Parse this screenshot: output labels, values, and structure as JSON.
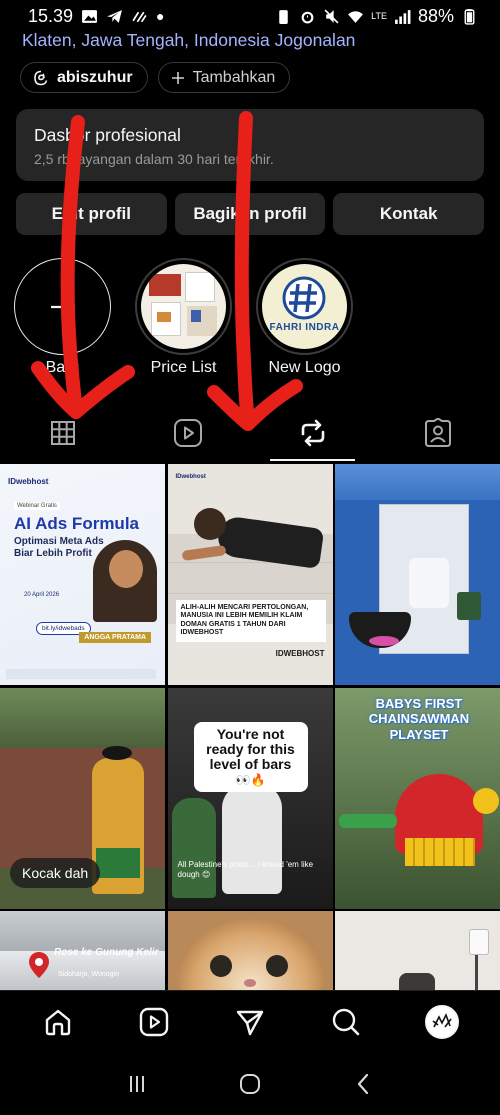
{
  "status_bar": {
    "time": "15.39",
    "battery_percent": "88%",
    "lte_label": "LTE",
    "volte_label": "Vo) LTE"
  },
  "profile": {
    "location": "Klaten, Jawa Tengah, Indonesia Jogonalan",
    "threads_handle": "abiszuhur",
    "add_label": "Tambahkan"
  },
  "dashboard": {
    "title": "Dasbor profesional",
    "subtitle": "2,5 rb tayangan dalam 30 hari terakhir."
  },
  "actions": {
    "edit_label": "Edit profil",
    "share_label": "Bagikan profil",
    "contact_label": "Kontak"
  },
  "highlights": [
    {
      "label": "Baru"
    },
    {
      "label": "Price List"
    },
    {
      "label": "New Logo",
      "logo_text": "FAHRI INDRA"
    }
  ],
  "tabs": [
    "grid-icon",
    "reels-icon",
    "reposts-icon",
    "tagged-icon"
  ],
  "active_tab": 2,
  "posts": {
    "p1": {
      "brand": "IDwebhost",
      "tag": "Webinar Gratis",
      "title": "AI Ads Formula",
      "subtitle": "Optimasi Meta Ads Biar Lebih Profit",
      "speaker": "ANGGA PRATAMA",
      "date": "20 April 2026",
      "link": "bit.ly/idwebads"
    },
    "p2": {
      "brand": "IDwebhost",
      "caption": "ALIH-ALIH MENCARI PERTOLONGAN, MANUSIA INI LEBIH MEMILIH KLAIM DOMAN GRATIS 1 TAHUN DARI IDWEBHOST",
      "tag": "IDWEBHOST"
    },
    "p4": {
      "overlay": "Kocak dah"
    },
    "p5": {
      "headline": "You're not ready for this level of bars",
      "emoji": "👀🔥",
      "caption": "All Palestine's poets... I knead 'em like dough 😊"
    },
    "p6": {
      "headline": "BABYS FIRST CHAINSAWMAN PLAYSET"
    },
    "p7": {
      "title": "Rose ke Gunung Kelir",
      "subtitle": "Sidoharjo, Wonogiri"
    }
  },
  "colors": {
    "background": "#000000",
    "card": "#262626",
    "location_link": "#a3b3ff",
    "annotation_red": "#e8201a"
  }
}
